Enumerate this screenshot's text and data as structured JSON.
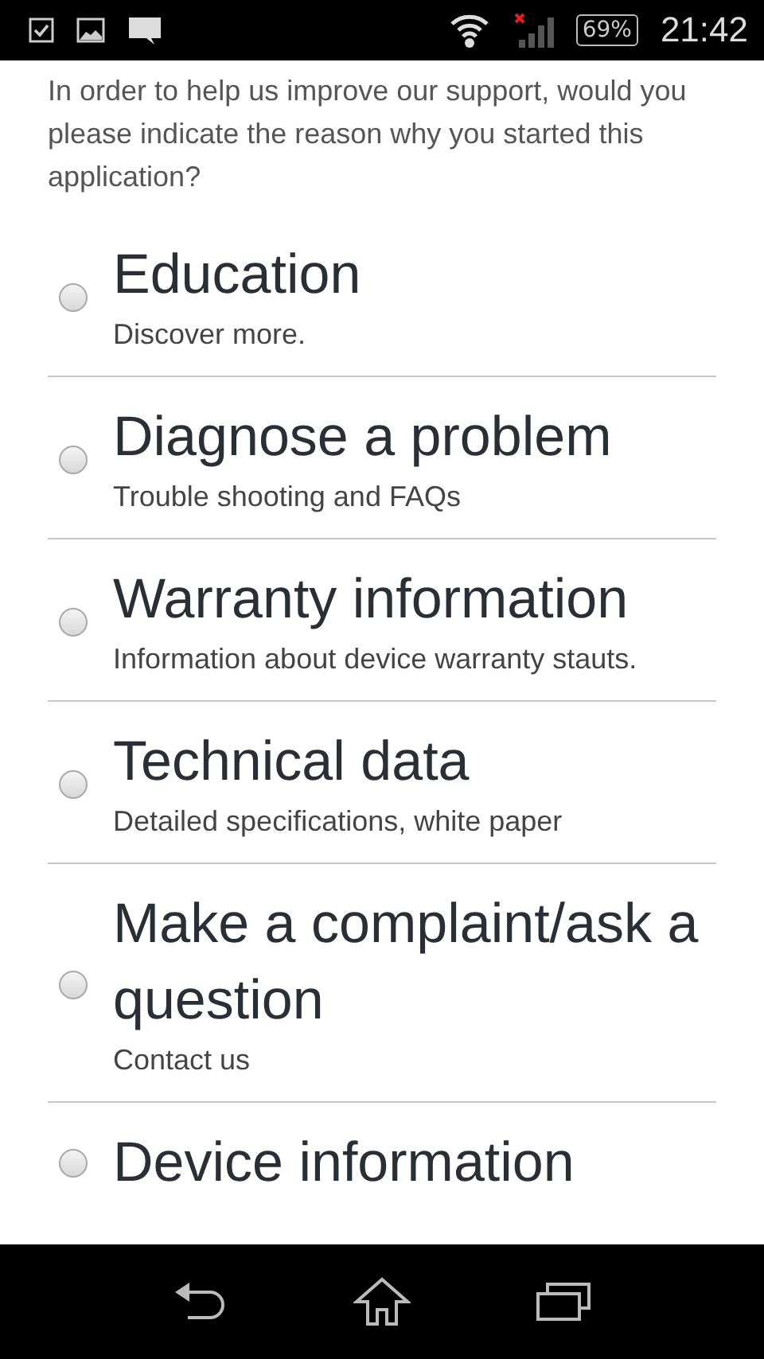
{
  "status_bar": {
    "battery": "69%",
    "time": "21:42"
  },
  "intro": "In order to help us improve our support, would you please indicate the reason why you started this application?",
  "options": [
    {
      "title": "Education",
      "subtitle": "Discover more.",
      "selected": false
    },
    {
      "title": "Diagnose a problem",
      "subtitle": "Trouble shooting and FAQs",
      "selected": false
    },
    {
      "title": "Warranty information",
      "subtitle": "Information about device warranty stauts.",
      "selected": false
    },
    {
      "title": "Technical data",
      "subtitle": "Detailed specifications, white paper",
      "selected": false
    },
    {
      "title": "Make a complaint/ask a question",
      "subtitle": "Contact us",
      "selected": false
    },
    {
      "title": "Device information",
      "selected": false
    }
  ]
}
